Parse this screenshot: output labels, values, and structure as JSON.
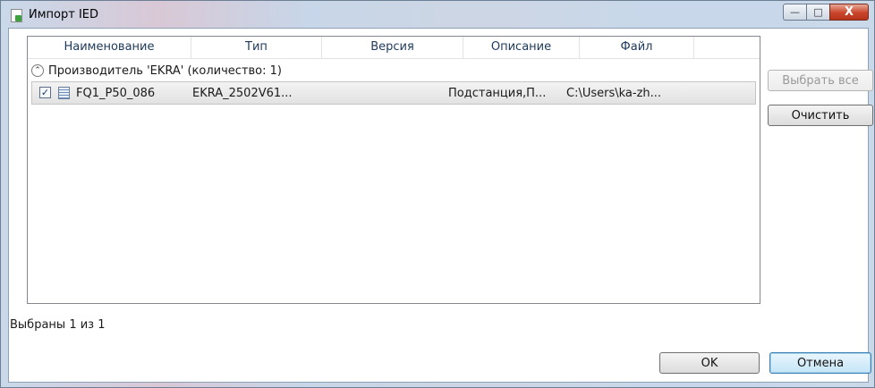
{
  "window": {
    "title": "Импорт IED",
    "min": "—",
    "max": "□",
    "close": "X"
  },
  "table": {
    "columns": [
      "Наименование",
      "Тип",
      "Версия",
      "Описание",
      "Файл"
    ],
    "group_label": "Производитель 'EKRA' (количество: 1)",
    "rows": [
      {
        "checked": true,
        "name": "FQ1_P50_086",
        "type": "EKRA_2502V61...",
        "version": "",
        "description": "Подстанция,П...",
        "file": "C:\\Users\\ka-zh..."
      }
    ]
  },
  "buttons": {
    "select_all": "Выбрать все",
    "clear": "Очистить",
    "ok": "OK",
    "cancel": "Отмена"
  },
  "status_text": "Выбраны 1 из 1",
  "icons": {
    "checkbox_mark": "✓",
    "collapse": "⌃"
  }
}
